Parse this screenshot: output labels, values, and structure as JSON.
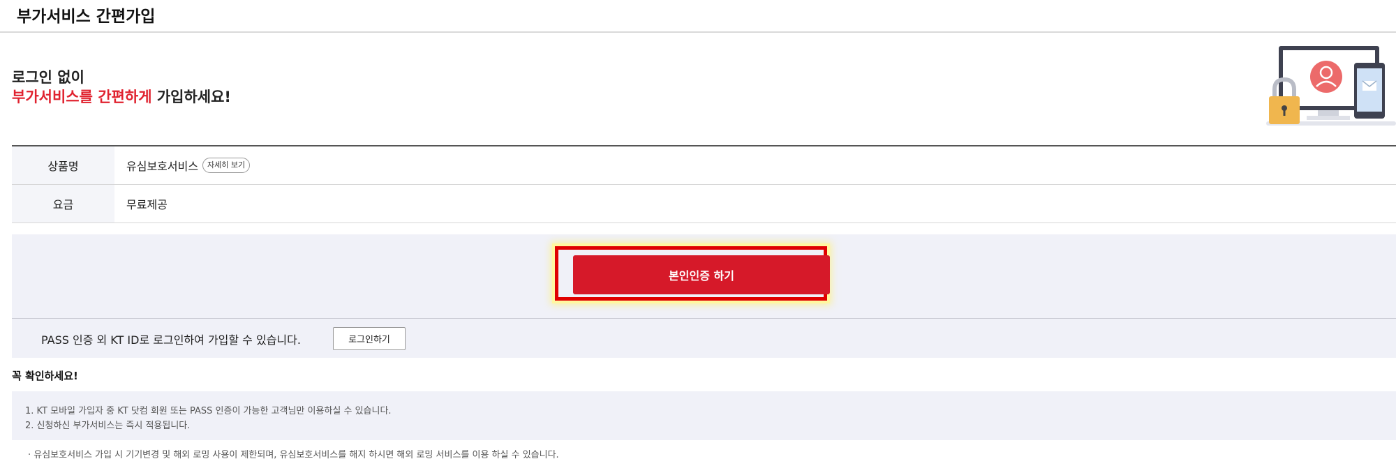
{
  "header": {
    "title": "부가서비스 간편가입"
  },
  "intro": {
    "line1": "로그인 없이",
    "line2_highlight": "부가서비스를 간편하게",
    "line2_rest": " 가입하세요!"
  },
  "illustration": {
    "icons": [
      "monitor-icon",
      "user-avatar-icon",
      "smartphone-icon",
      "mail-icon",
      "padlock-icon"
    ]
  },
  "info_table": {
    "rows": [
      {
        "label": "상품명",
        "value": "유심보호서비스",
        "detail_button": "자세히 보기"
      },
      {
        "label": "요금",
        "value": "무료제공"
      }
    ]
  },
  "auth": {
    "button_label": "본인인증 하기"
  },
  "login": {
    "text": "PASS 인증 외 KT ID로 로그인하여 가입할 수 있습니다.",
    "button_label": "로그인하기"
  },
  "notice": {
    "title": "꼭 확인하세요!",
    "items": [
      "1. KT 모바일 가입자 중 KT 닷컴 회원 또는 PASS 인증이 가능한 고객님만 이용하실 수 있습니다.",
      "2. 신청하신 부가서비스는 즉시 적용됩니다."
    ],
    "note": "· 유심보호서비스 가입 시 기기변경 및 해외 로밍 사용이 제한되며, 유심보호서비스를 해지 하시면 해외 로밍 서비스를 이용 하실 수 있습니다."
  },
  "colors": {
    "accent_red": "#d61929",
    "highlight_text_red": "#e0222f",
    "panel_bg": "#f0f1f8"
  }
}
